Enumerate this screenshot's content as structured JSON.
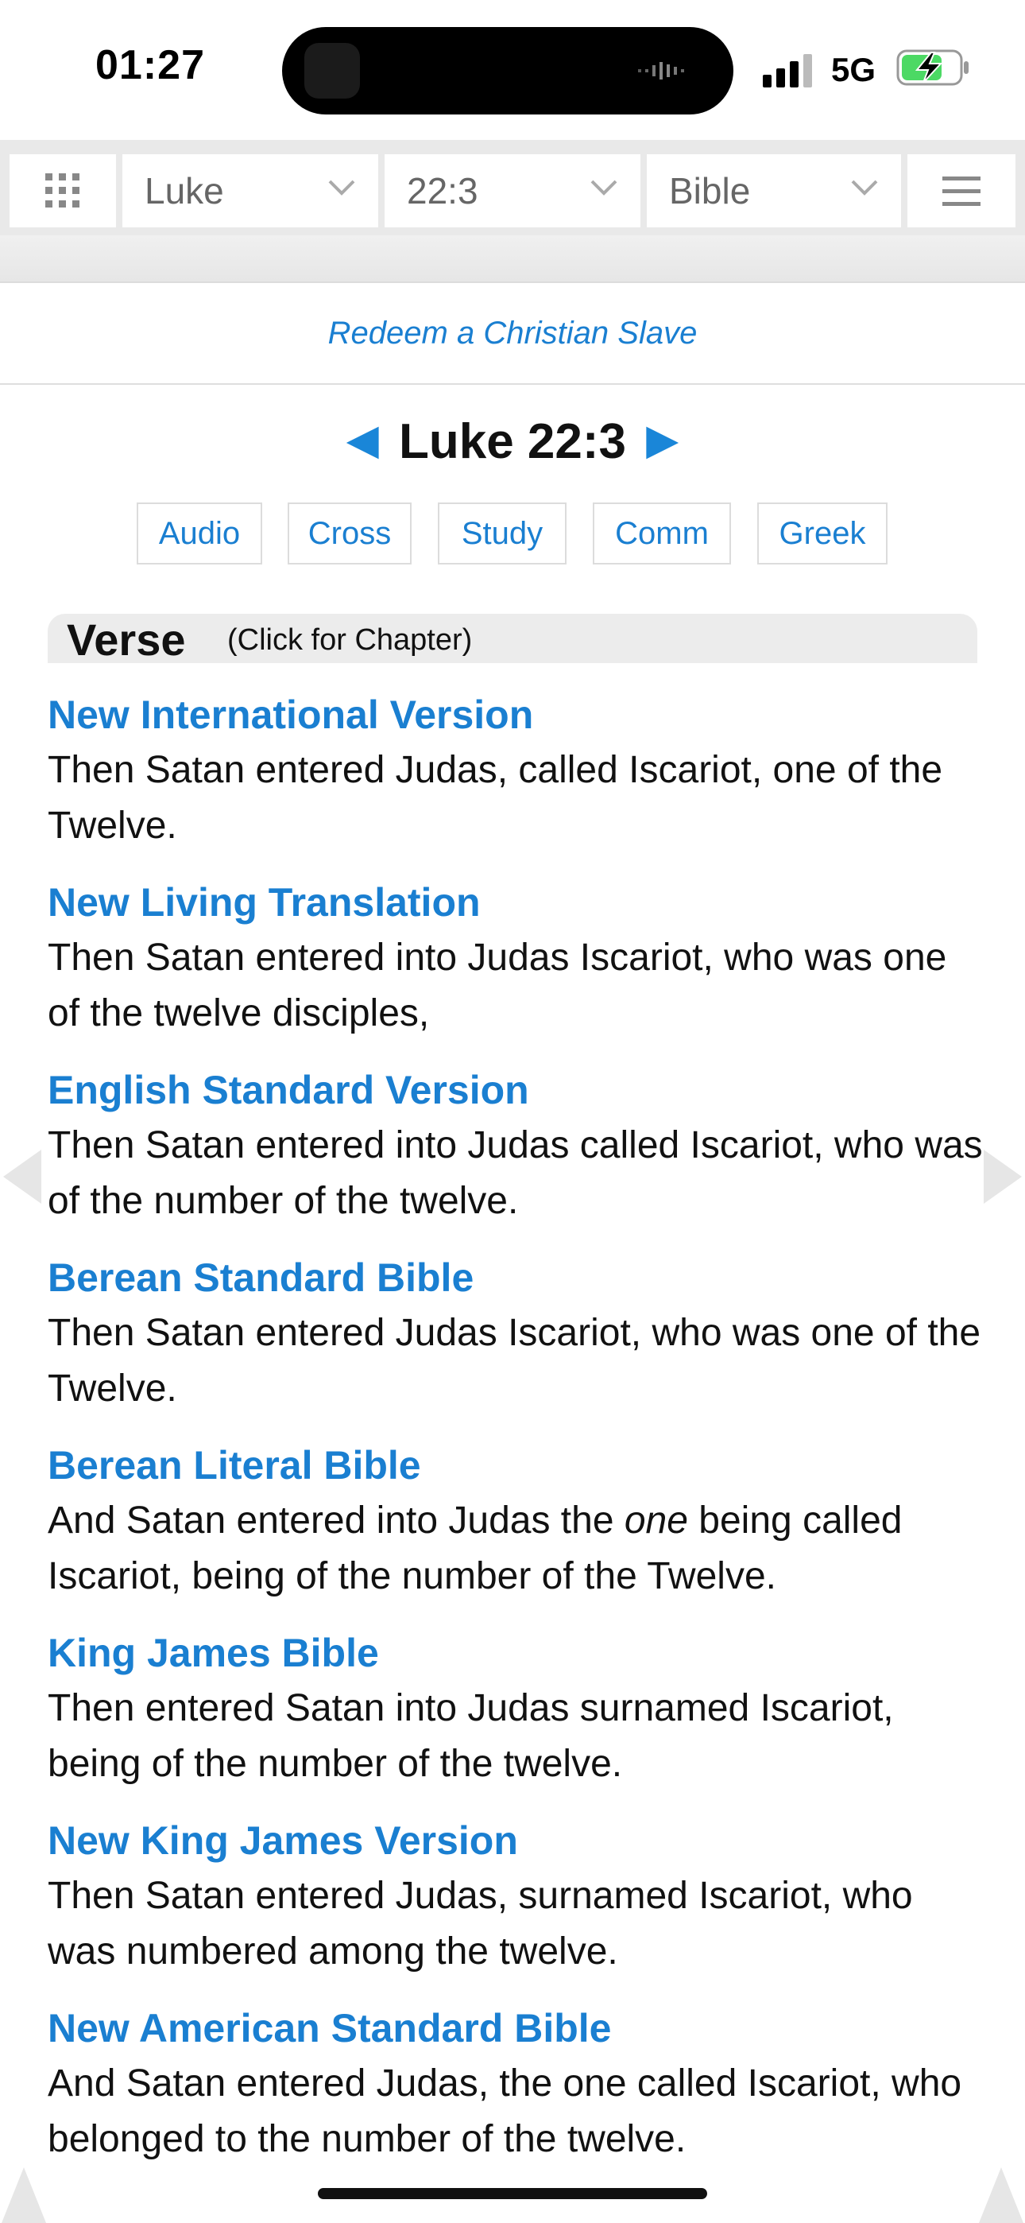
{
  "status": {
    "time": "01:27",
    "network": "5G"
  },
  "toolbar": {
    "book": "Luke",
    "verse": "22:3",
    "version": "Bible"
  },
  "ad": {
    "link_text": "Redeem a Christian Slave"
  },
  "heading": {
    "prev_arrow": "◀",
    "reference": "Luke 22:3",
    "next_arrow": "▶"
  },
  "tools": [
    "Audio",
    "Cross",
    "Study",
    "Comm",
    "Greek"
  ],
  "verse_section": {
    "label": "Verse",
    "hint": "(Click for Chapter)"
  },
  "versions": [
    {
      "name": "New International Version",
      "text": "Then Satan entered Judas, called Iscariot, one of the Twelve."
    },
    {
      "name": "New Living Translation",
      "text": "Then Satan entered into Judas Iscariot, who was one of the twelve disciples,"
    },
    {
      "name": "English Standard Version",
      "text": "Then Satan entered into Judas called Iscariot, who was of the number of the twelve."
    },
    {
      "name": "Berean Standard Bible",
      "text": "Then Satan entered Judas Iscariot, who was one of the Twelve."
    },
    {
      "name": "Berean Literal Bible",
      "text_before": "And Satan entered into Judas the ",
      "text_italic": "one",
      "text_after": " being called Iscariot, being of the number of the Twelve."
    },
    {
      "name": "King James Bible",
      "text": "Then entered Satan into Judas surnamed Iscariot, being of the number of the twelve."
    },
    {
      "name": "New King James Version",
      "text": "Then Satan entered Judas, surnamed Iscariot, who was numbered among the twelve."
    },
    {
      "name": "New American Standard Bible",
      "text": "And Satan entered Judas, the one called Iscariot, who belonged to the number of the twelve."
    }
  ],
  "colors": {
    "link": "#1a7fd1",
    "arrow": "#1a86d8",
    "toolbar_bg": "#e9e9e9"
  }
}
